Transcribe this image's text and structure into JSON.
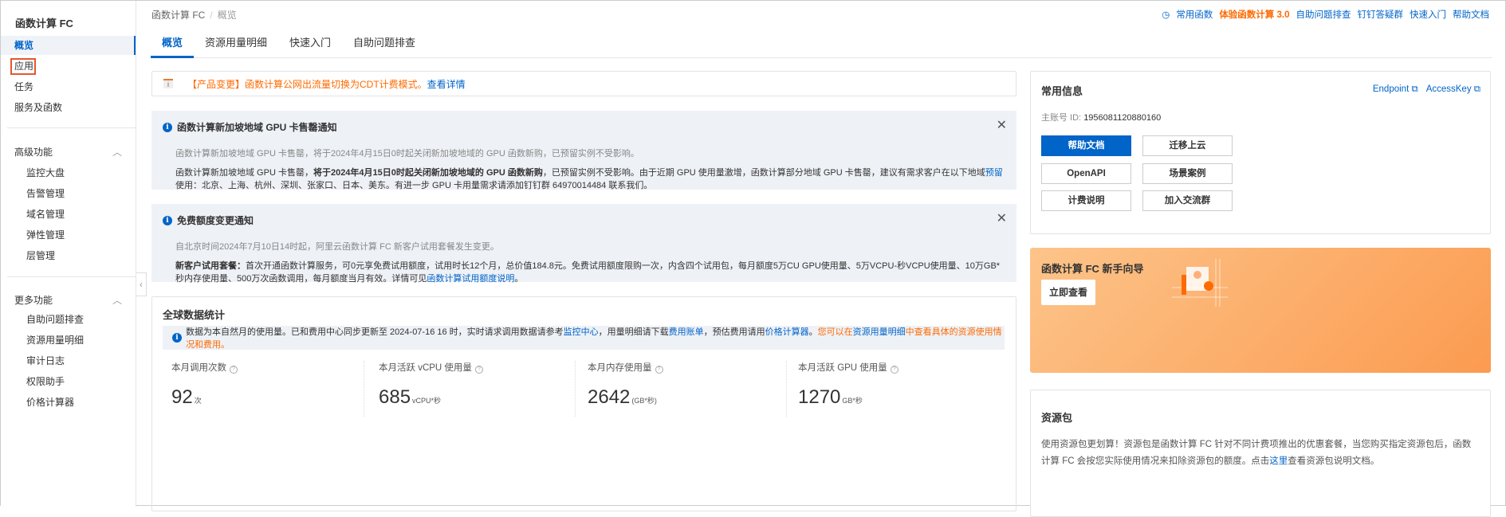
{
  "sidebar": {
    "title": "函数计算 FC",
    "items": [
      "概览",
      "应用",
      "任务",
      "服务及函数"
    ],
    "advanced": {
      "label": "高级功能",
      "items": [
        "监控大盘",
        "告警管理",
        "域名管理",
        "弹性管理",
        "层管理"
      ]
    },
    "more": {
      "label": "更多功能",
      "items": [
        "自助问题排查",
        "资源用量明细",
        "审计日志",
        "权限助手",
        "价格计算器"
      ]
    }
  },
  "breadcrumb": [
    "函数计算 FC",
    "概览"
  ],
  "toplinks": {
    "common": "常用函数",
    "try": "体验函数计算 3.0",
    "trouble": "自助问题排查",
    "dingding": "钉钉答疑群",
    "quick": "快速入门",
    "help": "帮助文档"
  },
  "tabs": [
    "概览",
    "资源用量明细",
    "快速入门",
    "自助问题排查"
  ],
  "banner": {
    "text": "【产品变更】函数计算公网出流量切换为CDT计费模式。",
    "link": "查看详情"
  },
  "notice1": {
    "title": "函数计算新加坡地域 GPU 卡售罄通知",
    "p1": "函数计算新加坡地域 GPU 卡售罄，将于2024年4月15日0时起关闭新加坡地域的 GPU 函数新购，已预留实例不受影响。",
    "p2a": "函数计算新加坡地域 GPU 卡售罄，",
    "p2b": "将于2024年4月15日0时起关闭新加坡地域的 GPU 函数新购",
    "p2c": "，已预留实例不受影响。由于近期 GPU 使用量激增，函数计算部分地域 GPU 卡售罄，建议有需求客户在以下地域",
    "p2link": "预留",
    "p2d": "使用：北京、上海、杭州、深圳、张家口、日本、美东。有进一步 GPU 卡用量需求请添加钉钉群 64970014484 联系我们。"
  },
  "notice2": {
    "title": "免费额度变更通知",
    "p1": "自北京时间2024年7月10日14时起，阿里云函数计算 FC 新客户试用套餐发生变更。",
    "p2a": "新客户试用套餐：",
    "p2b": "首次开通函数计算服务，可0元享免费试用额度，试用时长12个月，总价值184.8元。免费试用额度限购一次，内含四个试用包，每月额度5万CU GPU使用量、5万VCPU-秒VCPU使用量、10万GB*秒内存使用量、500万次函数调用，每月额度当月有效。详情可见",
    "p2link": "函数计算试用额度说明",
    "p2end": "。"
  },
  "stats": {
    "title": "全球数据统计",
    "tip": {
      "a": "数据为本自然月的使用量。已和费用中心同步更新至 2024-07-16 16 时，实时请求调用数据请参考",
      "l1": "监控中心",
      "b": "，用量明细请下载",
      "l2": "费用账单",
      "c": "，预估费用请用",
      "l3": "价格计算器",
      "d": "。",
      "e": "您可以在",
      "l4": "资源用量明细",
      "f": "中查看具体的资源使用情况和费用。"
    },
    "metrics": [
      {
        "label": "本月调用次数",
        "value": "92",
        "unit": "次"
      },
      {
        "label": "本月活跃 vCPU 使用量",
        "value": "685",
        "unit": "vCPU*秒"
      },
      {
        "label": "本月内存使用量",
        "value": "2642",
        "unit": "(GB*秒)"
      },
      {
        "label": "本月活跃 GPU 使用量",
        "value": "1270",
        "unit": "GB*秒"
      }
    ]
  },
  "info": {
    "title": "常用信息",
    "endpoint": "Endpoint",
    "accesskey": "AccessKey",
    "account_label": "主账号 ID:",
    "account_id": "1956081120880160",
    "buttons": [
      "帮助文档",
      "迁移上云",
      "OpenAPI",
      "场景案例",
      "计费说明",
      "加入交流群"
    ]
  },
  "guide": {
    "title": "函数计算 FC 新手向导",
    "button": "立即查看"
  },
  "package": {
    "title": "资源包",
    "text": "使用资源包更划算！资源包是函数计算 FC 针对不同计费项推出的优惠套餐，当您购买指定资源包后，函数计算 FC 会按您实际使用情况来扣除资源包的额度。点击",
    "link": "这里",
    "text2": "查看资源包说明文档。"
  }
}
